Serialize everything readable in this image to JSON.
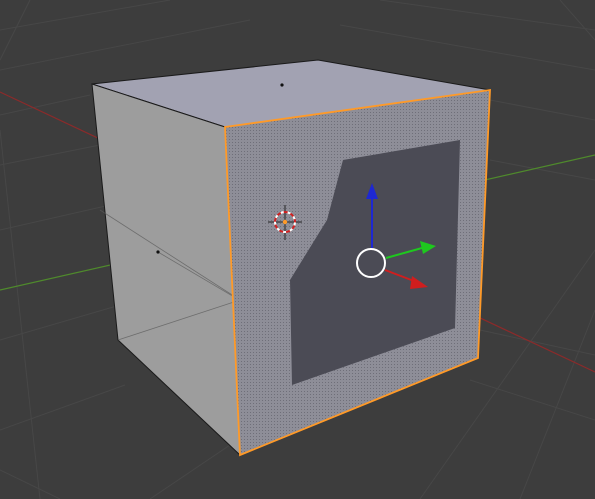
{
  "app": "blender-3d-viewport",
  "mode": "edit-mode-face-select",
  "colors": {
    "background": "#3d3d3d",
    "grid_line": "#474747",
    "x_axis": "#8c2a2a",
    "y_axis": "#4f8a2c",
    "face_top": "#a2a2b2",
    "face_left": "#9d9d9d",
    "face_selected": "#8e8e98",
    "face_dark": "#4b4b55",
    "wire": "#1a1a1a",
    "selection_outline": "#ff9a28",
    "gizmo_x": "#d01e1e",
    "gizmo_y": "#1ec81e",
    "gizmo_z": "#1e28d2",
    "cursor_red": "#d02020"
  },
  "scene": {
    "object_type": "cube",
    "selected_face": "front-right",
    "face_centers_visible": [
      "top",
      "left"
    ],
    "has_3d_cursor": true,
    "transform_gizmo": "move",
    "inset_region_visible": true
  }
}
